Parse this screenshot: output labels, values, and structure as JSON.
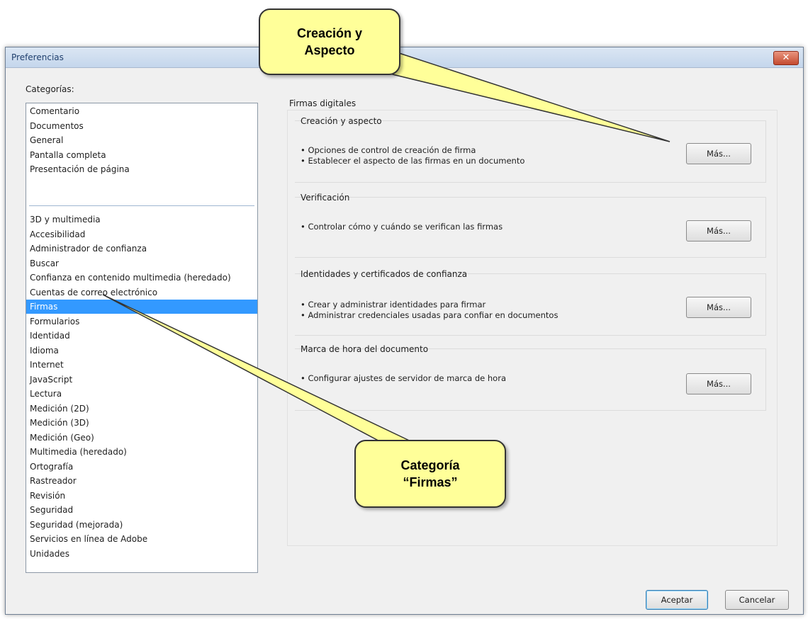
{
  "window": {
    "title": "Preferencias",
    "close_glyph": "✕"
  },
  "categories": {
    "label": "Categorías:",
    "group1": [
      "Comentario",
      "Documentos",
      "General",
      "Pantalla completa",
      "Presentación de página"
    ],
    "group2": [
      "3D y multimedia",
      "Accesibilidad",
      "Administrador de confianza",
      "Buscar",
      "Confianza en contenido multimedia (heredado)",
      "Cuentas de correo electrónico",
      "Firmas",
      "Formularios",
      "Identidad",
      "Idioma",
      "Internet",
      "JavaScript",
      "Lectura",
      "Medición (2D)",
      "Medición (3D)",
      "Medición (Geo)",
      "Multimedia (heredado)",
      "Ortografía",
      "Rastreador",
      "Revisión",
      "Seguridad",
      "Seguridad (mejorada)",
      "Servicios en línea de Adobe",
      "Unidades"
    ],
    "selected": "Firmas"
  },
  "panel": {
    "heading": "Firmas digitales",
    "sections": [
      {
        "title": "Creación y aspecto",
        "lines": [
          "• Opciones de control de creación de firma",
          "• Establecer el aspecto de las firmas en un documento"
        ],
        "button": "Más..."
      },
      {
        "title": "Verificación",
        "lines": [
          "• Controlar cómo y cuándo se verifican las firmas"
        ],
        "button": "Más..."
      },
      {
        "title": "Identidades y certificados de confianza",
        "lines": [
          "• Crear y administrar identidades para firmar",
          "• Administrar credenciales usadas para confiar en documentos"
        ],
        "button": "Más..."
      },
      {
        "title": "Marca de hora del documento",
        "lines": [
          "• Configurar ajustes de servidor de marca de hora"
        ],
        "button": "Más..."
      }
    ]
  },
  "footer": {
    "ok_label": "Aceptar",
    "cancel_label": "Cancelar"
  },
  "callouts": {
    "top_line1": "Creación y",
    "top_line2": "Aspecto",
    "bottom_line1": "Categoría",
    "bottom_line2": "“Firmas”"
  },
  "colors": {
    "selection": "#3399ff",
    "callout_fill": "#ffff99",
    "close_button": "#c44a2f"
  }
}
